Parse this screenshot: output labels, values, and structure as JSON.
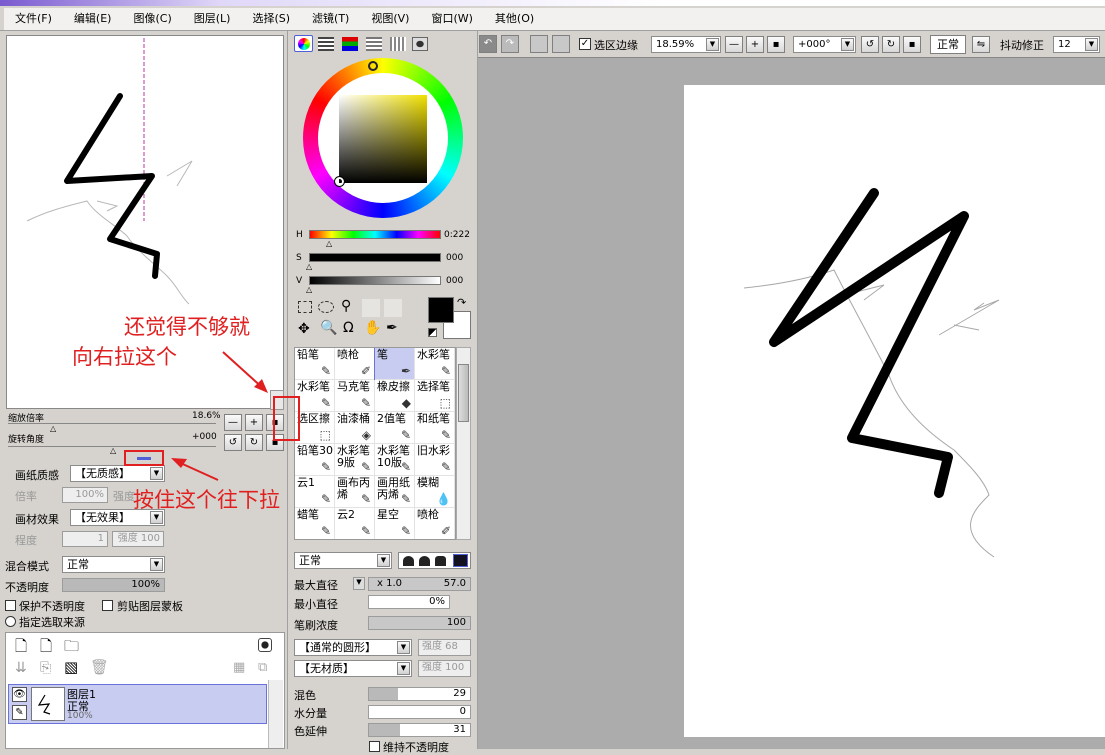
{
  "menu": [
    "文件(F)",
    "编辑(E)",
    "图像(C)",
    "图层(L)",
    "选择(S)",
    "滤镜(T)",
    "视图(V)",
    "窗口(W)",
    "其他(O)"
  ],
  "navigator": {
    "zoom_label": "缩放倍率",
    "zoom_value": "18.6%",
    "rotate_label": "旋转角度",
    "rotate_value": "+000"
  },
  "canvas_props": {
    "paper_texture_label": "画纸质感",
    "paper_texture_value": "【无质感】",
    "scale_label": "倍率",
    "scale_value": "100%",
    "intensity_label": "强度",
    "material_effect_label": "画材效果",
    "material_effect_value": "【无效果】",
    "degree_label": "程度",
    "degree_value": "1",
    "intensity_value": "强度 100"
  },
  "layer_props": {
    "blend_mode_label": "混合模式",
    "blend_mode_value": "正常",
    "opacity_label": "不透明度",
    "opacity_value": "100%",
    "protect_opacity": "保护不透明度",
    "clip_mask": "剪贴图层蒙板",
    "selection_source": "指定选取来源"
  },
  "layers": [
    {
      "name": "图层1",
      "mode": "正常",
      "opacity": "100%"
    }
  ],
  "color": {
    "h_label": "H",
    "h_value": "0:222",
    "s_label": "S",
    "s_value": "000",
    "v_label": "V",
    "v_value": "000",
    "fg": "#000000",
    "bg": "#ffffff"
  },
  "brushes": [
    [
      "铅笔",
      "喷枪",
      "笔",
      "水彩笔"
    ],
    [
      "水彩笔",
      "马克笔",
      "橡皮擦",
      "选择笔"
    ],
    [
      "选区擦",
      "油漆桶",
      "2值笔",
      "和纸笔"
    ],
    [
      "铅笔30",
      "水彩笔9版",
      "水彩笔10版",
      "旧水彩"
    ],
    [
      "云1",
      "画布丙烯",
      "画用纸丙烯",
      "模糊"
    ],
    [
      "蜡笔",
      "云2",
      "星空",
      "喷枪"
    ]
  ],
  "brush_settings": {
    "mode_value": "正常",
    "max_size_label": "最大直径",
    "max_size_mult": "x 1.0",
    "max_size_value": "57.0",
    "min_size_label": "最小直径",
    "min_size_value": "0%",
    "density_label": "笔刷浓度",
    "density_value": "100",
    "shape_value": "【通常的圆形】",
    "shape_intensity": "强度 68",
    "texture_value": "【无材质】",
    "texture_intensity": "强度 100",
    "blend_label": "混色",
    "blend_value": "29",
    "water_label": "水分量",
    "water_value": "0",
    "stretch_label": "色延伸",
    "stretch_value": "31",
    "keep_opacity": "维持不透明度"
  },
  "toolbar": {
    "selection_edge": "选区边缘",
    "zoom": "18.59%",
    "rotation": "+000°",
    "mode": "正常",
    "stabilizer_label": "抖动修正",
    "stabilizer_value": "12"
  },
  "annotations": {
    "right_note_1": "还觉得不够就",
    "right_note_2": "向右拉这个",
    "down_note": "按住这个往下拉"
  },
  "colors": {
    "highlight": "#e02020",
    "accent": "#6a74d8"
  }
}
